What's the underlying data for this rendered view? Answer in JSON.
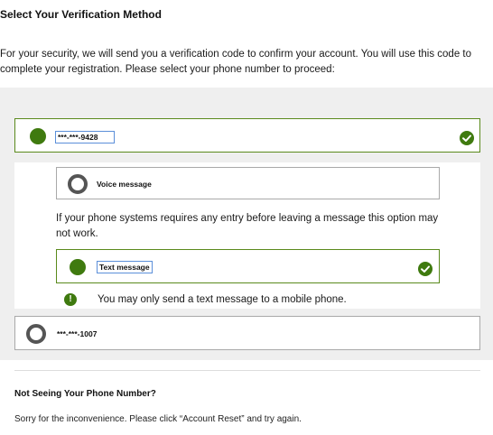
{
  "title": "Select Your Verification Method",
  "intro": "For your security, we will send you a verification code to confirm your account. You will use this code to complete your registration. Please select your phone number to proceed:",
  "phones": [
    {
      "label": "***-***-9428",
      "selected": true
    },
    {
      "label": "***-***-1007",
      "selected": false
    }
  ],
  "methods": {
    "voice": {
      "label": "Voice message",
      "selected": false
    },
    "text": {
      "label": "Text message",
      "selected": true
    }
  },
  "voice_warning": "If your phone systems requires any entry before leaving a message this option may not work.",
  "text_note": "You may only send a text message to a mobile phone.",
  "info_icon_glyph": "!",
  "help": {
    "heading": "Not Seeing Your Phone Number?",
    "text": "Sorry for the inconvenience. Please click “Account Reset” and try again."
  },
  "colors": {
    "accent": "#3f7a0f",
    "selected_border": "#5a8a1c",
    "panel_bg": "#efefef"
  },
  "icons": {
    "selected_check": "check-circle-icon",
    "info": "exclamation-circle-icon"
  }
}
